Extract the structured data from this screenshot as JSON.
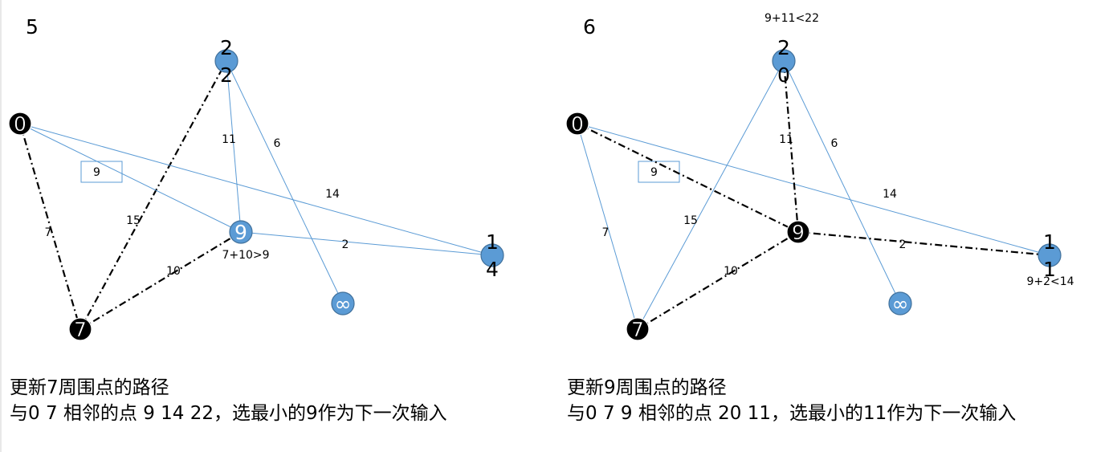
{
  "panels": [
    {
      "step": "5",
      "weight_box": "9",
      "nodes": [
        {
          "id": "n0",
          "label": "0",
          "state": "visited"
        },
        {
          "id": "n7",
          "label": "7",
          "state": "visited"
        },
        {
          "id": "n9",
          "label": "9",
          "state": "open"
        },
        {
          "id": "n2",
          "label": "2\n2",
          "state": "open"
        },
        {
          "id": "n1",
          "label": "1\n4",
          "state": "open"
        },
        {
          "id": "ninf",
          "label": "∞",
          "state": "open"
        }
      ],
      "edges": [
        {
          "from": "n0",
          "to": "n7",
          "weight": "7",
          "style": "dashdot"
        },
        {
          "from": "n7",
          "to": "n2",
          "weight": "15",
          "style": "dashdot"
        },
        {
          "from": "n7",
          "to": "n9",
          "weight": "10",
          "style": "dashdot"
        },
        {
          "from": "n0",
          "to": "n9",
          "weight": "",
          "style": "solid"
        },
        {
          "from": "n0",
          "to": "n1",
          "weight": "14",
          "style": "solid"
        },
        {
          "from": "n2",
          "to": "n9",
          "weight": "11",
          "style": "solid"
        },
        {
          "from": "n2",
          "to": "ninf",
          "weight": "6",
          "style": "solid"
        },
        {
          "from": "n9",
          "to": "n1",
          "weight": "2",
          "style": "solid"
        }
      ],
      "annotations": [
        "7+10>9"
      ],
      "caption_line1": "更新7周围点的路径",
      "caption_line2": "与0 7 相邻的点  9  14  22，选最小的9作为下一次输入"
    },
    {
      "step": "6",
      "weight_box": "9",
      "nodes": [
        {
          "id": "n0",
          "label": "0",
          "state": "visited"
        },
        {
          "id": "n7",
          "label": "7",
          "state": "visited"
        },
        {
          "id": "n9",
          "label": "9",
          "state": "visited"
        },
        {
          "id": "n2",
          "label": "2\n0",
          "state": "open"
        },
        {
          "id": "n1",
          "label": "1\n1",
          "state": "open"
        },
        {
          "id": "ninf",
          "label": "∞",
          "state": "open"
        }
      ],
      "edges": [
        {
          "from": "n0",
          "to": "n7",
          "weight": "7",
          "style": "solid"
        },
        {
          "from": "n7",
          "to": "n2",
          "weight": "15",
          "style": "solid"
        },
        {
          "from": "n7",
          "to": "n9",
          "weight": "10",
          "style": "dashdot"
        },
        {
          "from": "n0",
          "to": "n9",
          "weight": "",
          "style": "dashdot"
        },
        {
          "from": "n0",
          "to": "n1",
          "weight": "14",
          "style": "solid"
        },
        {
          "from": "n2",
          "to": "n9",
          "weight": "11",
          "style": "dashdot"
        },
        {
          "from": "n2",
          "to": "ninf",
          "weight": "6",
          "style": "solid"
        },
        {
          "from": "n9",
          "to": "n1",
          "weight": "2",
          "style": "dashdot"
        }
      ],
      "annotations": [
        "9+11<22",
        "9+2<14"
      ],
      "caption_line1": "更新9周围点的路径",
      "caption_line2": "与0 7 9 相邻的点  20 11，选最小的11作为下一次输入"
    }
  ],
  "colors": {
    "visited_fill": "#000000",
    "visited_stroke": "#ffffff",
    "open_fill": "#5b9bd5",
    "open_stroke": "#41719c",
    "solid_edge": "#5b9bd5",
    "dash_edge": "#000000"
  }
}
